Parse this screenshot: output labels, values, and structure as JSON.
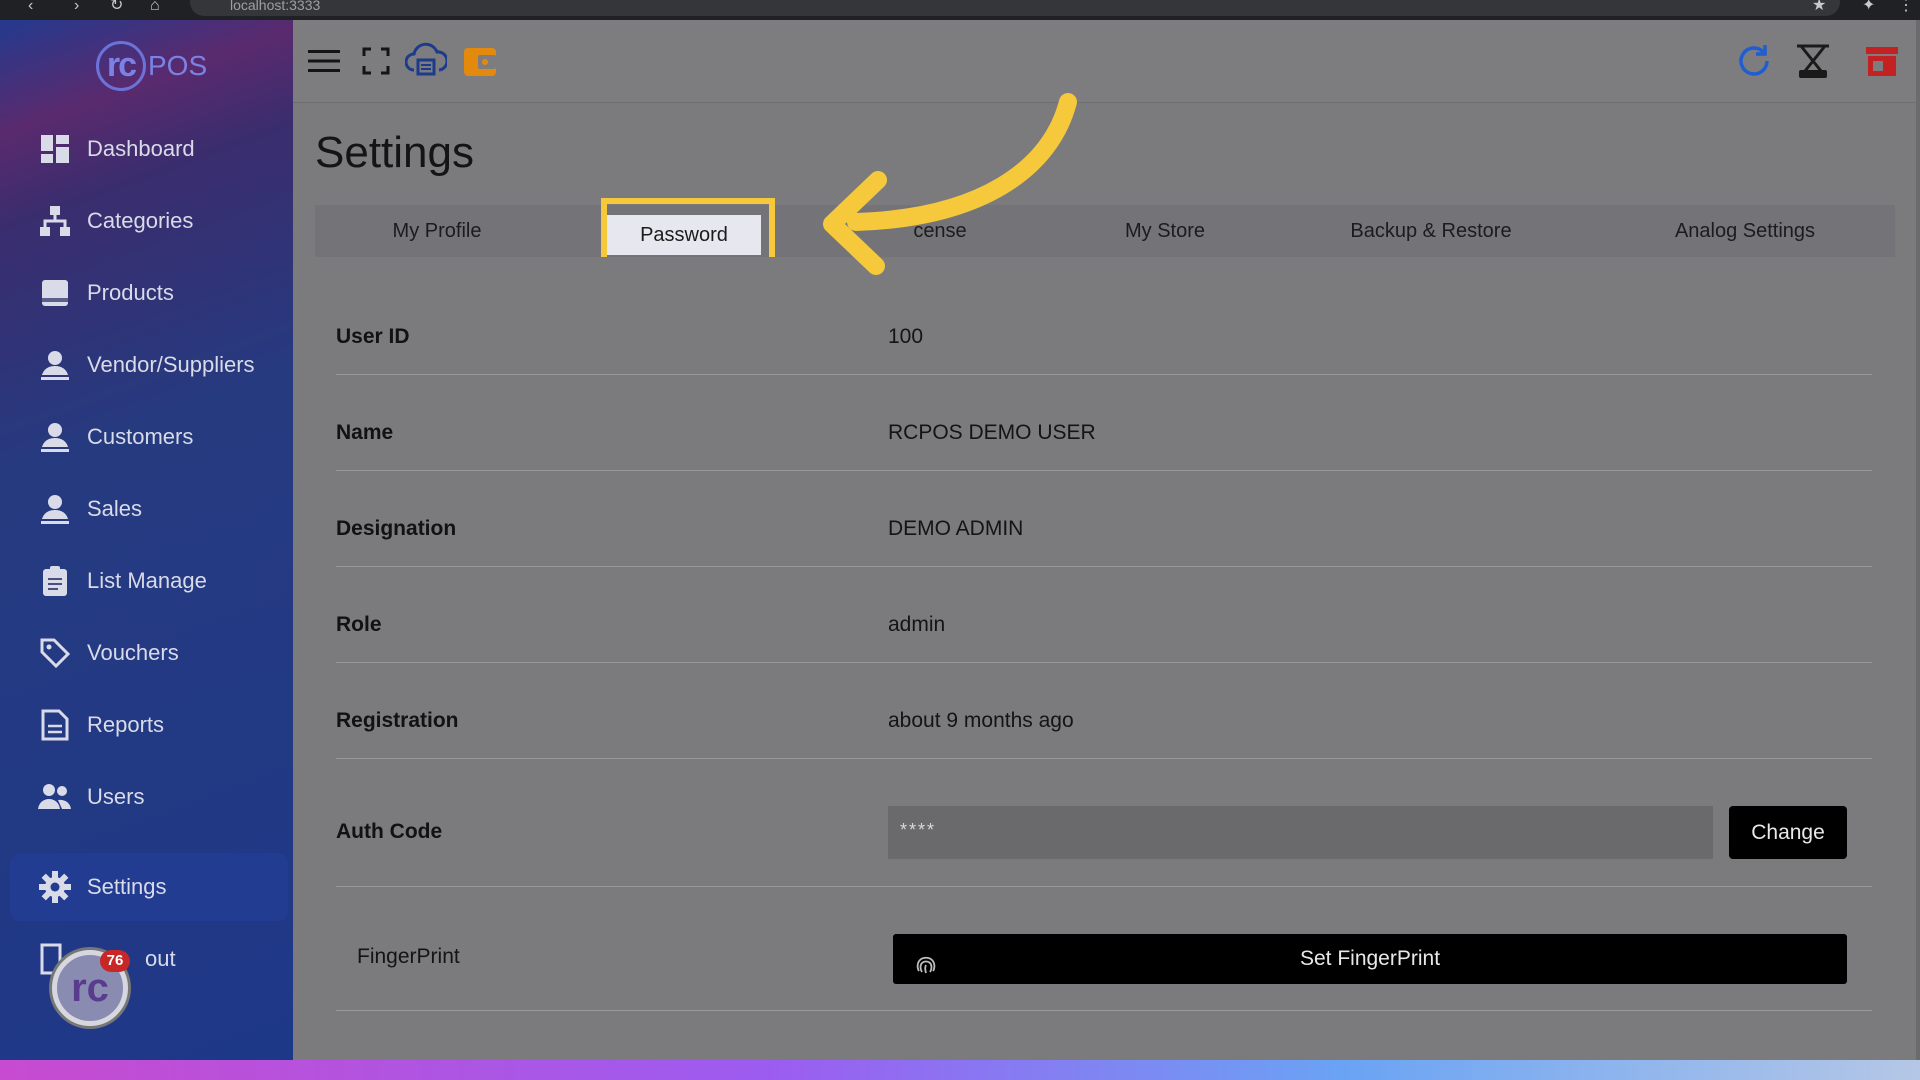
{
  "browser": {
    "url": "localhost:3333"
  },
  "app": {
    "logo_text": "POS",
    "logo_mark": "rc",
    "notification_count": "76"
  },
  "sidebar": {
    "items": [
      {
        "label": "Dashboard",
        "icon": "dashboard-icon"
      },
      {
        "label": "Categories",
        "icon": "sitemap-icon"
      },
      {
        "label": "Products",
        "icon": "box-icon"
      },
      {
        "label": "Vendor/Suppliers",
        "icon": "person-icon"
      },
      {
        "label": "Customers",
        "icon": "person-icon"
      },
      {
        "label": "Sales",
        "icon": "person-icon"
      },
      {
        "label": "List Manage",
        "icon": "clipboard-icon"
      },
      {
        "label": "Vouchers",
        "icon": "tag-icon"
      },
      {
        "label": "Reports",
        "icon": "document-icon"
      },
      {
        "label": "Users",
        "icon": "users-icon"
      },
      {
        "label": "Settings",
        "icon": "gear-icon"
      },
      {
        "label": "Logout",
        "icon": "logout-icon"
      }
    ],
    "logout_visible": "out"
  },
  "topbar": {
    "icons": [
      "menu-icon",
      "fullscreen-icon",
      "cloud-print-icon",
      "wallet-icon",
      "refresh-icon",
      "scale-icon",
      "store-icon"
    ]
  },
  "page": {
    "title": "Settings"
  },
  "tabs": [
    {
      "label": "My Profile"
    },
    {
      "label": "Password"
    },
    {
      "label": "cense"
    },
    {
      "label": "My Store"
    },
    {
      "label": "Backup & Restore"
    },
    {
      "label": "Analog Settings"
    }
  ],
  "profile": {
    "rows": [
      {
        "label": "User ID",
        "value": "100"
      },
      {
        "label": "Name",
        "value": "RCPOS DEMO USER"
      },
      {
        "label": "Designation",
        "value": "DEMO ADMIN"
      },
      {
        "label": "Role",
        "value": "admin"
      },
      {
        "label": "Registration",
        "value": "about 9 months ago"
      }
    ],
    "auth_code": {
      "label": "Auth Code",
      "value": "****",
      "button": "Change"
    },
    "fingerprint": {
      "label": "FingerPrint",
      "button": "Set FingerPrint"
    }
  },
  "colors": {
    "highlight": "#f5c93b",
    "arrow": "#f5c93b",
    "sidebar_active": "#223c92"
  }
}
